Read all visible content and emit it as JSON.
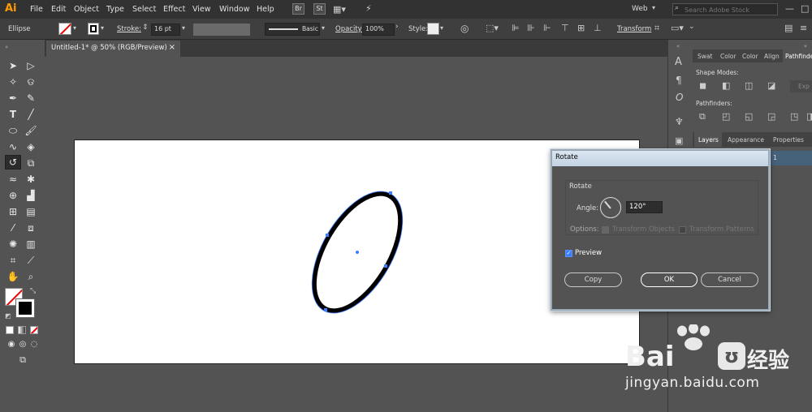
{
  "app": {
    "logo": "Ai"
  },
  "menu": [
    "File",
    "Edit",
    "Object",
    "Type",
    "Select",
    "Effect",
    "View",
    "Window",
    "Help"
  ],
  "menu_right": {
    "br": "Br",
    "st": "St",
    "workspace": "Web",
    "search_placeholder": "Search Adobe Stock"
  },
  "control_bar": {
    "object_type": "Ellipse",
    "stroke_label": "Stroke:",
    "stroke_value": "16 pt",
    "brush": "Basic",
    "opacity_label": "Opacity:",
    "opacity_value": "100%",
    "style_label": "Style:",
    "transform_label": "Transform"
  },
  "document": {
    "tab_title": "Untitled-1* @ 50% (RGB/Preview)",
    "close": "×"
  },
  "panels": {
    "top_tabs": [
      "Swat",
      "Color",
      "Color",
      "Align",
      "Pathfinde"
    ],
    "shape_modes": "Shape Modes:",
    "pathfinders": "Pathfinders:",
    "expand": "Exp",
    "bottom_tabs": [
      "Layers",
      "Appearance",
      "Properties"
    ],
    "layer_number": "1"
  },
  "dialog": {
    "title": "Rotate",
    "section": "Rotate",
    "angle_label": "Angle:",
    "angle_value": "120°",
    "angle_numeric": 120,
    "options_label": "Options:",
    "transform_objects": "Transform Objects",
    "transform_patterns": "Transform Patterns",
    "preview_label": "Preview",
    "preview_checked": true,
    "copy_btn": "Copy",
    "ok_btn": "OK",
    "cancel_btn": "Cancel"
  },
  "watermark": {
    "brand": "Bai",
    "brand2": "经验",
    "url": "jingyan.baidu.com"
  },
  "colors": {
    "accent": "#ff9a00",
    "selection": "#3d7dff",
    "ok_border": "#ffffff"
  }
}
